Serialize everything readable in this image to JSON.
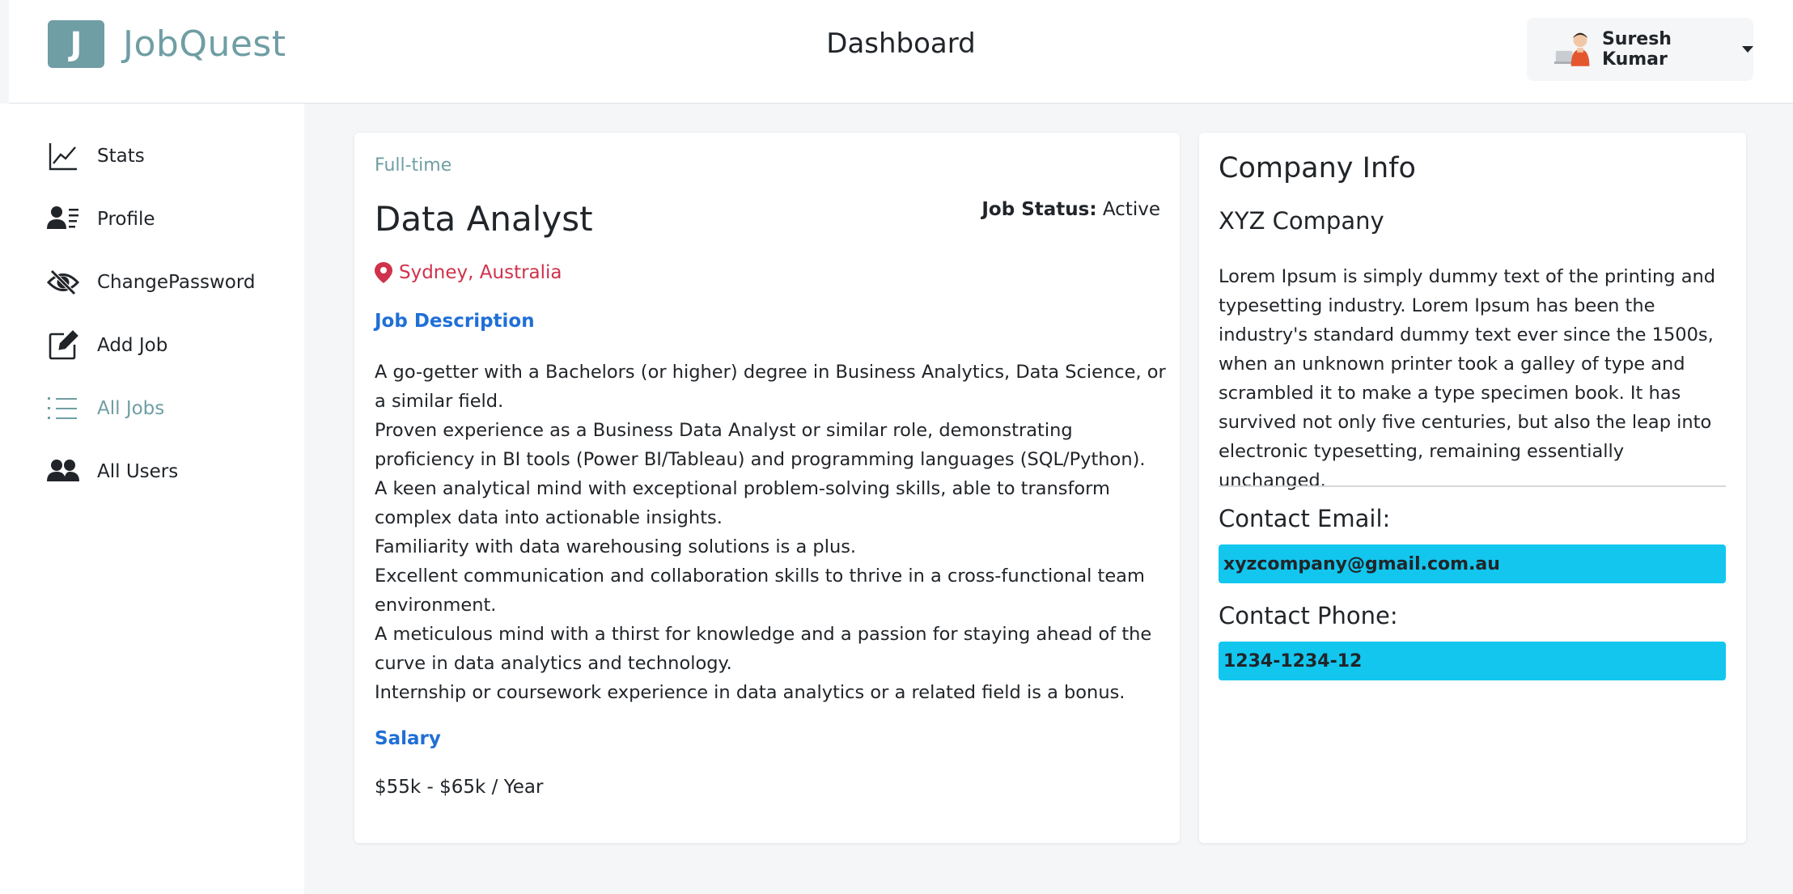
{
  "app": {
    "brand_letter": "J",
    "brand_name": "JobQuest",
    "page_title": "Dashboard",
    "accent_color": "#6f9ea4"
  },
  "user": {
    "name": "Suresh Kumar",
    "avatar_icon": "user-avatar-illustration"
  },
  "sidebar": {
    "items": [
      {
        "label": "Stats",
        "icon": "line-chart-icon",
        "active": false
      },
      {
        "label": "Profile",
        "icon": "user-card-icon",
        "active": false
      },
      {
        "label": "ChangePassword",
        "icon": "eye-slash-icon",
        "active": false
      },
      {
        "label": "Add Job",
        "icon": "pencil-square-icon",
        "active": false
      },
      {
        "label": "All Jobs",
        "icon": "list-icon",
        "active": true
      },
      {
        "label": "All Users",
        "icon": "users-icon",
        "active": false
      }
    ]
  },
  "job": {
    "type": "Full-time",
    "title": "Data Analyst",
    "status_label": "Job Status:",
    "status_value": "Active",
    "location": "Sydney, Australia",
    "description_heading": "Job Description",
    "description_lines": [
      "A go-getter with a Bachelors (or higher) degree in Business Analytics, Data Science, or a similar field.",
      "Proven experience as a Business Data Analyst or similar role, demonstrating proficiency in BI tools (Power BI/Tableau) and programming languages (SQL/Python).",
      "A keen analytical mind with exceptional problem-solving skills, able to transform complex data into actionable insights.",
      "Familiarity with data warehousing solutions is a plus.",
      "Excellent communication and collaboration skills to thrive in a cross-functional team environment.",
      "A meticulous mind with a thirst for knowledge and a passion for staying ahead of the curve in data analytics and technology.",
      "Internship or coursework experience in data analytics or a related field is a bonus."
    ],
    "salary_heading": "Salary",
    "salary": "$55k - $65k / Year"
  },
  "company": {
    "heading": "Company Info",
    "name": "XYZ Company",
    "about": "Lorem Ipsum is simply dummy text of the printing and typesetting industry. Lorem Ipsum has been the industry's standard dummy text ever since the 1500s, when an unknown printer took a galley of type and scrambled it to make a type specimen book. It has survived not only five centuries, but also the leap into electronic typesetting, remaining essentially unchanged.",
    "email_label": "Contact Email:",
    "email": "xyzcompany@gmail.com.au",
    "phone_label": "Contact Phone:",
    "phone": "1234-1234-12",
    "contact_bg_color": "#12c6ee"
  },
  "colors": {
    "location": "#d0324b",
    "section_heading": "#1f6fd6"
  }
}
